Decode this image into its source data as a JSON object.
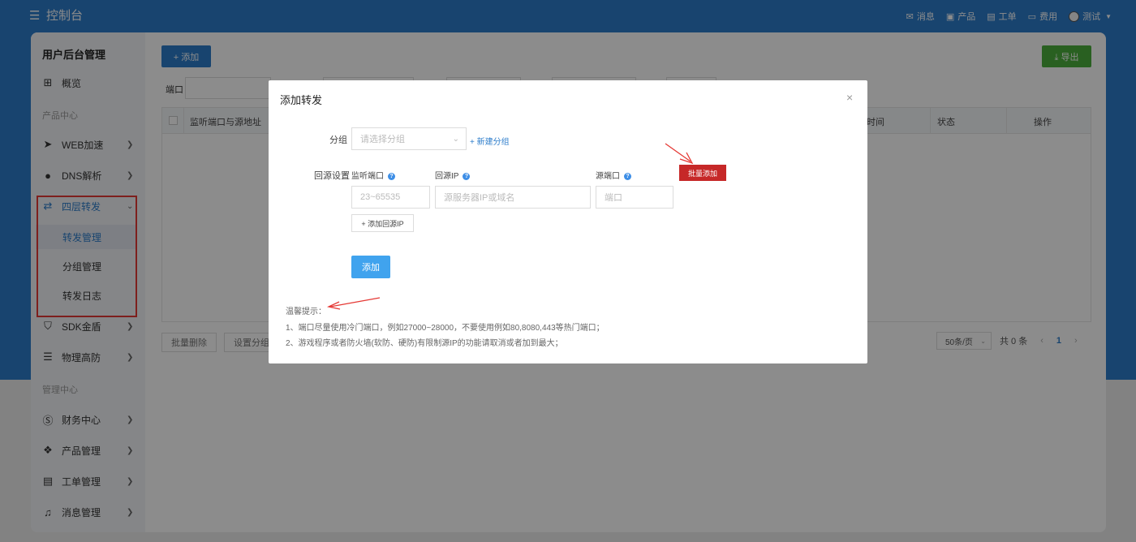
{
  "topbar": {
    "title": "控制台",
    "nav": [
      {
        "icon": "mail-icon",
        "glyph": "✉",
        "label": "消息"
      },
      {
        "icon": "box-icon",
        "glyph": "▣",
        "label": "产品"
      },
      {
        "icon": "ticket-icon",
        "glyph": "▤",
        "label": "工单"
      },
      {
        "icon": "folder-icon",
        "glyph": "▭",
        "label": "费用"
      }
    ],
    "user": "测试"
  },
  "sidebar": {
    "title": "用户后台管理",
    "overview": "概览",
    "section_product": "产品中心",
    "web": "WEB加速",
    "dns": "DNS解析",
    "l4": "四层转发",
    "sub_forward": "转发管理",
    "sub_group": "分组管理",
    "sub_log": "转发日志",
    "sdk": "SDK金盾",
    "phys": "物理高防",
    "section_manage": "管理中心",
    "finance": "财务中心",
    "prodmgmt": "产品管理",
    "ticketmgmt": "工单管理",
    "msgmgmt": "消息管理"
  },
  "content": {
    "add_btn": "+ 添加",
    "export_btn": "⤓ 导出",
    "filter_port_label": "端口",
    "table": {
      "col_listen": "监听端口与源地址",
      "col_time": "时间",
      "col_status": "状态",
      "col_action": "操作"
    },
    "batch_delete": "批量删除",
    "set_group": "设置分组",
    "page_size": "50条/页",
    "total": "共 0 条",
    "prev": "‹",
    "page": "1",
    "next": "›"
  },
  "dialog": {
    "title": "添加转发",
    "close": "×",
    "group_label": "分组",
    "group_placeholder": "请选择分组",
    "new_group": "+ 新建分组",
    "origin_label": "回源设置",
    "listen_port_label": "监听端口",
    "origin_ip_label": "回源IP",
    "source_port_label": "源端口",
    "batch_add": "批量添加",
    "listen_port_placeholder": "23~65535",
    "origin_ip_placeholder": "源服务器IP或域名",
    "source_port_placeholder": "端口",
    "add_origin_ip": "+  添加回源IP",
    "submit": "添加",
    "tips_title": "温馨提示：",
    "tip1": "1、端口尽量使用冷门端口，例如27000~28000，不要使用例如80,8080,443等热门端口；",
    "tip2": "2、游戏程序或者防火墙(软防、硬防)有限制源IP的功能请取消或者加到最大；"
  },
  "colors": {
    "brand": "#2d7dcb",
    "export": "#4caf3d",
    "danger": "#c62828",
    "submit": "#40a3ee",
    "annotation": "#e53935"
  }
}
